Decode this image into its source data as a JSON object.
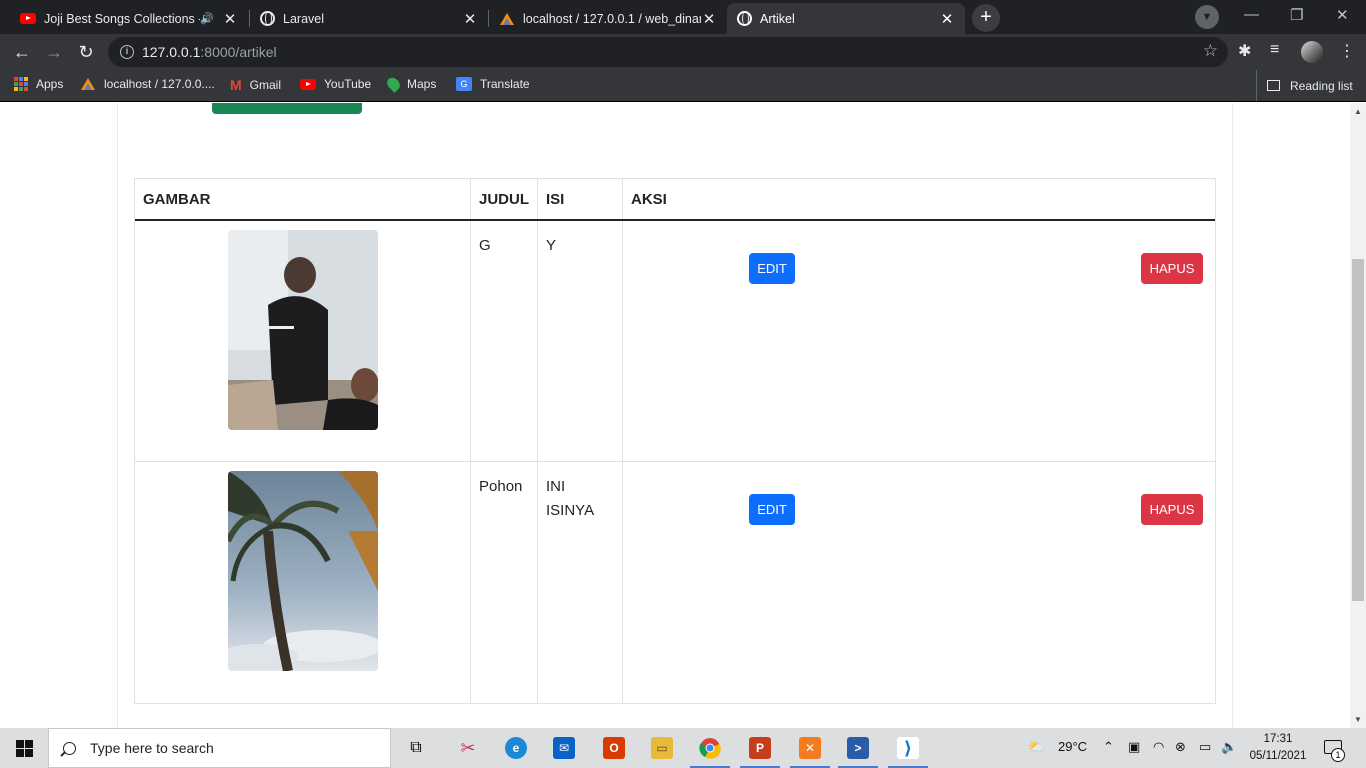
{
  "browser": {
    "tabs": [
      {
        "title": "Joji Best Songs Collections -",
        "icon": "youtube-icon",
        "audio": true
      },
      {
        "title": "Laravel",
        "icon": "globe-icon"
      },
      {
        "title": "localhost / 127.0.0.1 / web_dinam",
        "icon": "phpmyadmin-icon"
      },
      {
        "title": "Artikel",
        "icon": "globe-icon",
        "active": true
      }
    ],
    "url_host": "127.0.0.1",
    "url_rest": ":8000/artikel",
    "bookmarks": [
      {
        "label": "Apps",
        "icon": "apps-grid-icon"
      },
      {
        "label": "localhost / 127.0.0....",
        "icon": "phpmyadmin-icon"
      },
      {
        "label": "Gmail",
        "icon": "gmail-icon"
      },
      {
        "label": "YouTube",
        "icon": "youtube-icon"
      },
      {
        "label": "Maps",
        "icon": "maps-icon"
      },
      {
        "label": "Translate",
        "icon": "translate-icon"
      }
    ],
    "reading_list": "Reading list"
  },
  "table": {
    "headers": {
      "gambar": "GAMBAR",
      "judul": "JUDUL",
      "isi": "ISI",
      "aksi": "AKSI"
    },
    "rows": [
      {
        "judul": "G",
        "isi": "Y",
        "edit": "EDIT",
        "hapus": "HAPUS"
      },
      {
        "judul": "Pohon",
        "isi": "INI ISINYA",
        "edit": "EDIT",
        "hapus": "HAPUS"
      }
    ]
  },
  "taskbar": {
    "search_placeholder": "Type here to search",
    "weather": "29°C",
    "time": "17:31",
    "date": "05/11/2021",
    "notifications": "1"
  },
  "colors": {
    "primary": "#0d6efd",
    "danger": "#dc3545",
    "success": "#198754"
  }
}
